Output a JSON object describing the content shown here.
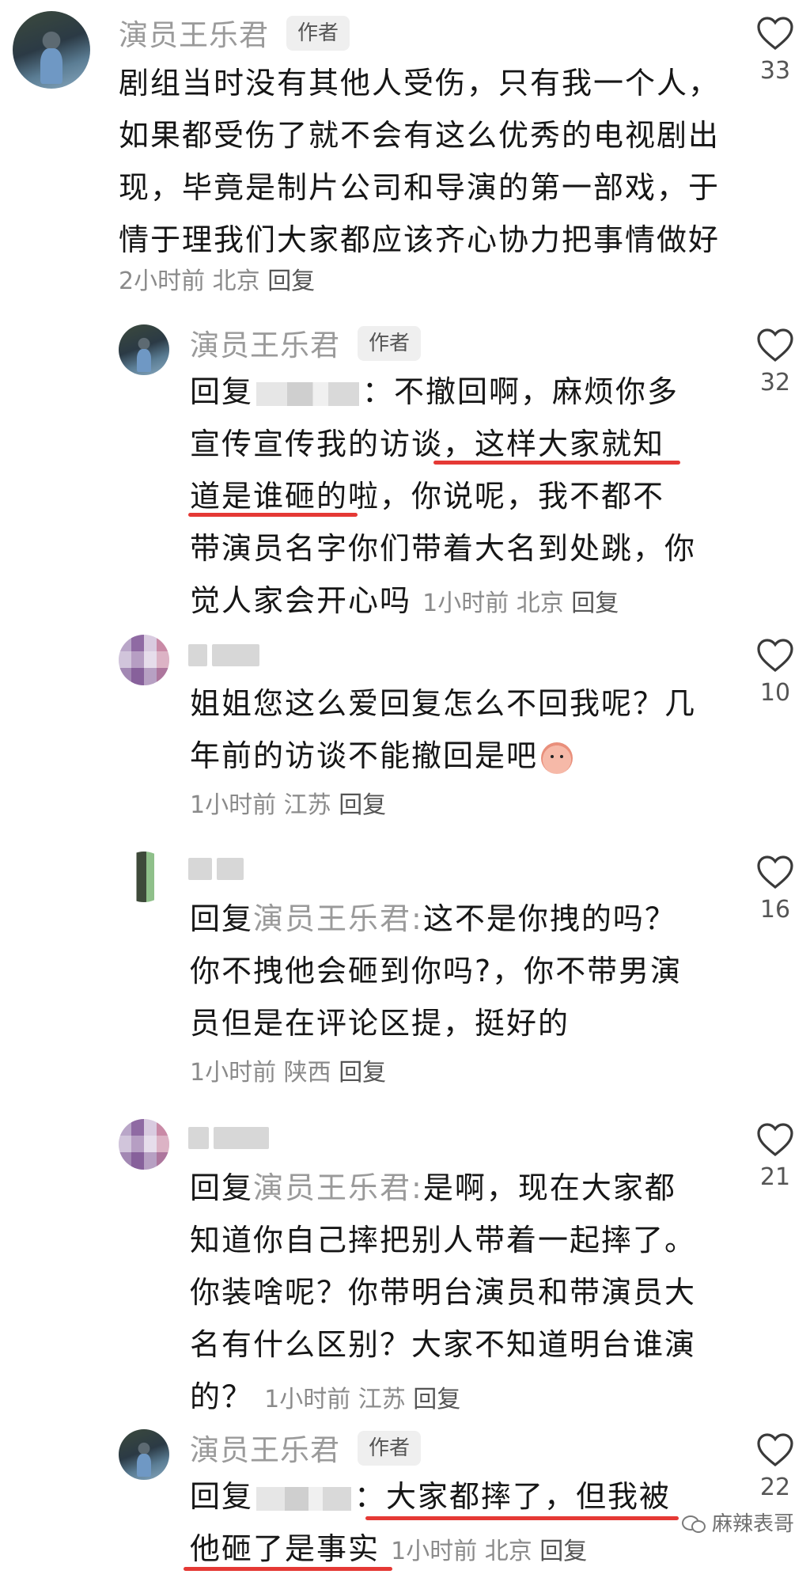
{
  "comments": [
    {
      "author": "演员王乐君",
      "badge": "作者",
      "text": "剧组当时没有其他人受伤，只有我一个人，如果都受伤了就不会有这么优秀的电视剧出现，毕竟是制片公司和导演的第一部戏，于情于理我们大家都应该齐心协力把事情做好",
      "time": "2小时前",
      "location": "北京",
      "reply_label": "回复",
      "likes": "33"
    },
    {
      "author": "演员王乐君",
      "badge": "作者",
      "prefix": "回复",
      "text_a": "：不撤回啊，麻烦你多宣传宣传我的访谈，",
      "text_highlight": "这样大家就知道是谁砸的啦，",
      "text_b": "你说呢，我不都不带演员名字你们带着大名到处跳，你觉人家会开心吗",
      "time": "1小时前",
      "location": "北京",
      "reply_label": "回复",
      "likes": "32"
    },
    {
      "text": "姐姐您这么爱回复怎么不回我呢？几年前的访谈不能撤回是吧",
      "time": "1小时前",
      "location": "江苏",
      "reply_label": "回复",
      "likes": "10"
    },
    {
      "prefix": "回复",
      "target": "演员王乐君:",
      "text": "这不是你拽的吗？你不拽他会砸到你吗?，你不带男演员但是在评论区提，挺好的",
      "time": "1小时前",
      "location": "陕西",
      "reply_label": "回复",
      "likes": "16"
    },
    {
      "prefix": "回复",
      "target": "演员王乐君:",
      "text": "是啊，现在大家都知道你自己摔把别人带着一起摔了。你装啥呢？你带明台演员和带演员大名有什么区别？大家不知道明台谁演的？",
      "time": "1小时前",
      "location": "江苏",
      "reply_label": "回复",
      "likes": "21"
    },
    {
      "author": "演员王乐君",
      "badge": "作者",
      "prefix": "回复",
      "text_highlight": "：大家都摔了，但我被他砸了是事实",
      "time": "1小时前",
      "location": "北京",
      "reply_label": "回复",
      "likes": "22"
    }
  ],
  "watermark": "麻辣表哥",
  "colors": {
    "highlight_underline": "#e53935",
    "meta": "#8a8a8a",
    "username": "#9a9a9a"
  },
  "icons": {
    "like": "heart-outline-icon"
  }
}
